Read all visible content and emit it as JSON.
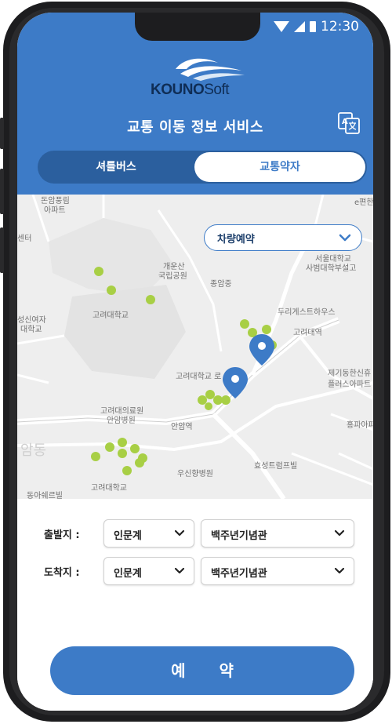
{
  "status_bar": {
    "time": "12:30"
  },
  "header": {
    "logo_brand": "KOUNO",
    "logo_suffix": "Soft",
    "title": "교통 이동 정보 서비스"
  },
  "tabs": [
    {
      "label": "셔틀버스",
      "active": false
    },
    {
      "label": "교통약자",
      "active": true
    }
  ],
  "map": {
    "vehicle_dropdown": {
      "selected": "차량예약"
    },
    "labels": [
      "돈암풍림",
      "아파트",
      "센터",
      "개운산",
      "국립공원",
      "종암중",
      "서울대학교",
      "사범대학부설고",
      "고려대학교",
      "두리게스트하우스",
      "고려대역",
      "성신여자",
      "대학교",
      "고려대학교 로",
      "제기동한신휴",
      "플러스아파트",
      "고려대의료원",
      "안암병원",
      "안암역",
      "홍파아파",
      "우신향병원",
      "효성트럼프빌",
      "고려대학교",
      "e편한",
      "암동",
      "동아쉐르빌"
    ]
  },
  "form": {
    "departure": {
      "label": "출발지 :",
      "zone": "인문계",
      "building": "백주년기념관"
    },
    "arrival": {
      "label": "도착지 :",
      "zone": "인문계",
      "building": "백주년기념관"
    }
  },
  "reserve_button": "예 약",
  "colors": {
    "primary": "#3d7bc7",
    "tab_bar": "#2b5f9e",
    "marker_green": "#a8cf45",
    "map_bg": "#eeeeee"
  }
}
